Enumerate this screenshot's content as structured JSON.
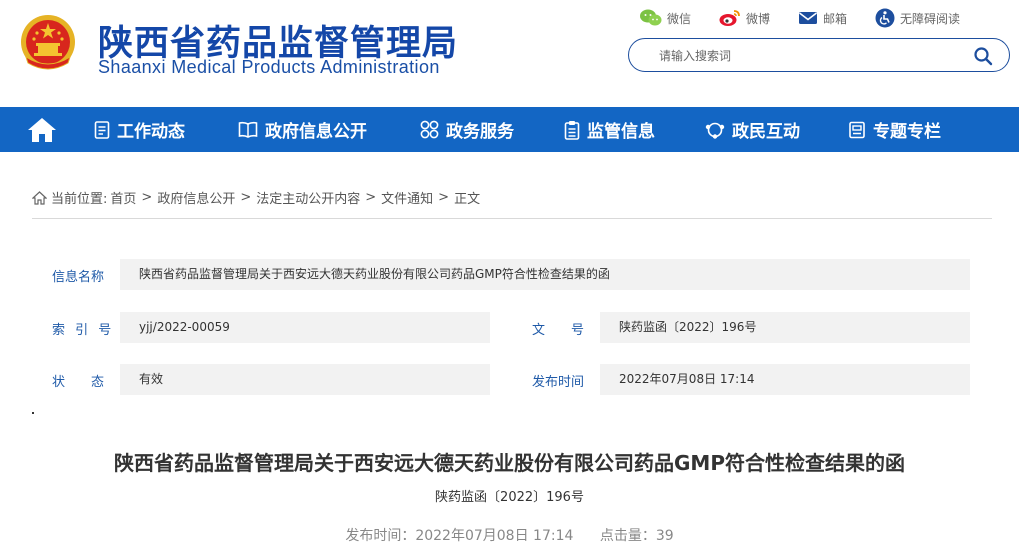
{
  "site": {
    "title": "陕西省药品监督管理局",
    "subtitle": "Shaanxi Medical Products Administration"
  },
  "top_links": {
    "wechat": "微信",
    "weibo": "微博",
    "email": "邮箱",
    "accessibility": "无障碍阅读"
  },
  "search": {
    "placeholder": "请输入搜索词"
  },
  "nav": {
    "items": [
      {
        "label": "工作动态",
        "icon": "document-list-icon"
      },
      {
        "label": "政府信息公开",
        "icon": "book-icon"
      },
      {
        "label": "政务服务",
        "icon": "grid-circles-icon"
      },
      {
        "label": "监管信息",
        "icon": "clipboard-icon"
      },
      {
        "label": "政民互动",
        "icon": "handshake-icon"
      },
      {
        "label": "专题专栏",
        "icon": "folder-icon"
      }
    ]
  },
  "breadcrumb": {
    "prefix": "当前位置:",
    "items": [
      "首页",
      "政府信息公开",
      "法定主动公开内容",
      "文件通知",
      "正文"
    ]
  },
  "info": {
    "name_label": "信息名称",
    "name_value": "陕西省药品监督管理局关于西安远大德天药业股份有限公司药品GMP符合性检查结果的函",
    "index_label": "索 引 号",
    "index_value": "yjj/2022-00059",
    "docno_label": "文　　号",
    "docno_value": "陕药监函〔2022〕196号",
    "status_label": "状　　态",
    "status_value": "有效",
    "pubtime_label": "发布时间",
    "pubtime_value": "2022年07月08日 17:14"
  },
  "article": {
    "title": "陕西省药品监督管理局关于西安远大德天药业股份有限公司药品GMP符合性检查结果的函",
    "doc_number": "陕药监函〔2022〕196号",
    "published": "发布时间：2022年07月08日 17:14",
    "hits": "点击量：39"
  },
  "colors": {
    "brand_blue": "#1447a8",
    "nav_blue": "#1366c4",
    "label_blue": "#1f5aa8"
  }
}
